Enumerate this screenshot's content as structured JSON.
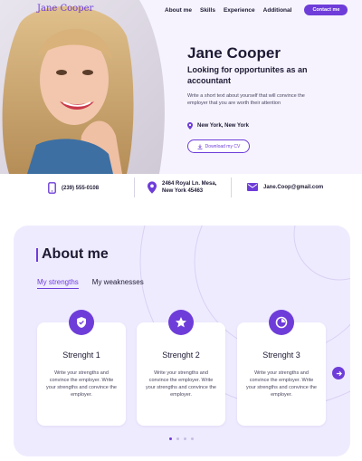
{
  "header": {
    "brand": "Jane Cooper",
    "nav": [
      "About me",
      "Skills",
      "Experience",
      "Additional"
    ],
    "contact_button": "Contact me"
  },
  "hero": {
    "name": "Jane Cooper",
    "role": "Looking for opportunites as an accountant",
    "description": "Write a short text about yourself that will convince the employer that you are worth their attention",
    "location": "New York, New York",
    "cv_button": "Download my CV"
  },
  "contacts": {
    "phone": "(239) 555-0108",
    "address_line1": "2464 Royal Ln. Mesa,",
    "address_line2": "New York 45463",
    "email": "Jane.Coop@gmail.com"
  },
  "about": {
    "title": "About me",
    "tabs": [
      "My strengths",
      "My weaknesses"
    ],
    "cards": [
      {
        "icon": "shield-check-icon",
        "title": "Strenght 1",
        "text": "Write your strengths and convince the employer. Write your strengths and convince the employer."
      },
      {
        "icon": "star-icon",
        "title": "Strenght 2",
        "text": "Write your strengths and convince the employer. Write your strengths and convince the employer."
      },
      {
        "icon": "pie-chart-icon",
        "title": "Strenght 3",
        "text": "Write your strengths and convince the employer. Write your strengths and convince the employer."
      }
    ],
    "pagination_count": 4,
    "pagination_active": 0
  },
  "colors": {
    "accent": "#6e3dd9",
    "hero_bg": "#f6f3ff",
    "section_bg": "#efebff",
    "text": "#1d1a33"
  }
}
